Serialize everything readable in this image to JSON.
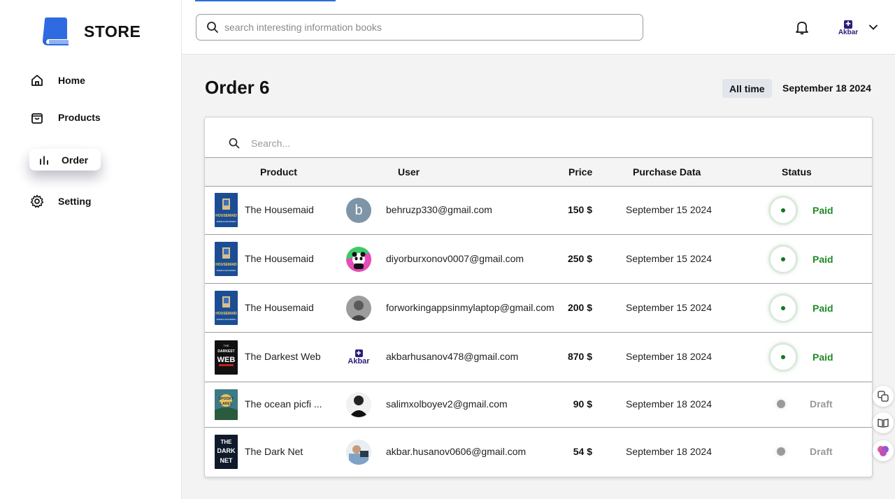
{
  "brand": {
    "name": "STORE"
  },
  "sidebar": {
    "items": [
      {
        "label": "Home",
        "icon": "home-icon"
      },
      {
        "label": "Products",
        "icon": "shopping-bag-icon"
      },
      {
        "label": "Order",
        "icon": "bar-chart-icon",
        "active": true
      },
      {
        "label": "Setting",
        "icon": "gear-icon"
      }
    ]
  },
  "topbar": {
    "search_placeholder": "search interesting information books",
    "account_logo_text": "Akbar"
  },
  "page": {
    "title": "Order 6",
    "filter_label": "All time",
    "date": "September 18 2024"
  },
  "table": {
    "search_placeholder": "Search...",
    "columns": [
      "Product",
      "User",
      "Price",
      "Purchase Data",
      "Status"
    ],
    "rows": [
      {
        "product": "The Housemaid",
        "book_cover": "The Housemaid cover",
        "user_avatar": "b",
        "email": "behruzp330@gmail.com",
        "price": "150 $",
        "date": "September 15 2024",
        "status": "Paid"
      },
      {
        "product": "The Housemaid",
        "book_cover": "The Housemaid cover",
        "user_avatar": "panda",
        "email": "diyorburxonov0007@gmail.com",
        "price": "250 $",
        "date": "September 15 2024",
        "status": "Paid"
      },
      {
        "product": "The Housemaid",
        "book_cover": "The Housemaid cover",
        "user_avatar": "photo",
        "email": "forworkingappsinmylaptop@gmail.com",
        "price": "200 $",
        "date": "September 15 2024",
        "status": "Paid"
      },
      {
        "product": "The Darkest Web",
        "book_cover": "The Darkest Web cover",
        "user_avatar": "akbar-logo",
        "email": "akbarhusanov478@gmail.com",
        "price": "870 $",
        "date": "September 18 2024",
        "status": "Paid"
      },
      {
        "product": "The ocean picfi ...",
        "book_cover": "Spooky Lakes cover",
        "user_avatar": "photo",
        "email": "salimxolboyev2@gmail.com",
        "price": "90 $",
        "date": "September 18 2024",
        "status": "Draft"
      },
      {
        "product": "The Dark Net",
        "book_cover": "The Dark Net cover",
        "user_avatar": "photo",
        "email": "akbar.husanov0606@gmail.com",
        "price": "54 $",
        "date": "September 18 2024",
        "status": "Draft"
      }
    ]
  },
  "colors": {
    "brand_blue": "#2f6be0",
    "paid_green": "#1f8a26",
    "draft_gray": "#9a9a9a",
    "accent_navy": "#2a1e7a"
  },
  "cover_texts": {
    "housemaid_title": "HOUSEMAID",
    "housemaid_author": "FREIDA McFADDEN",
    "darkest_top": "THE",
    "darkest_mid": "DARKEST",
    "darkest_big": "WEB",
    "spooky_top": "SPOOKY",
    "spooky_bottom": "LAKES",
    "darknet_1": "THE",
    "darknet_2": "DARK",
    "darknet_3": "NET"
  }
}
